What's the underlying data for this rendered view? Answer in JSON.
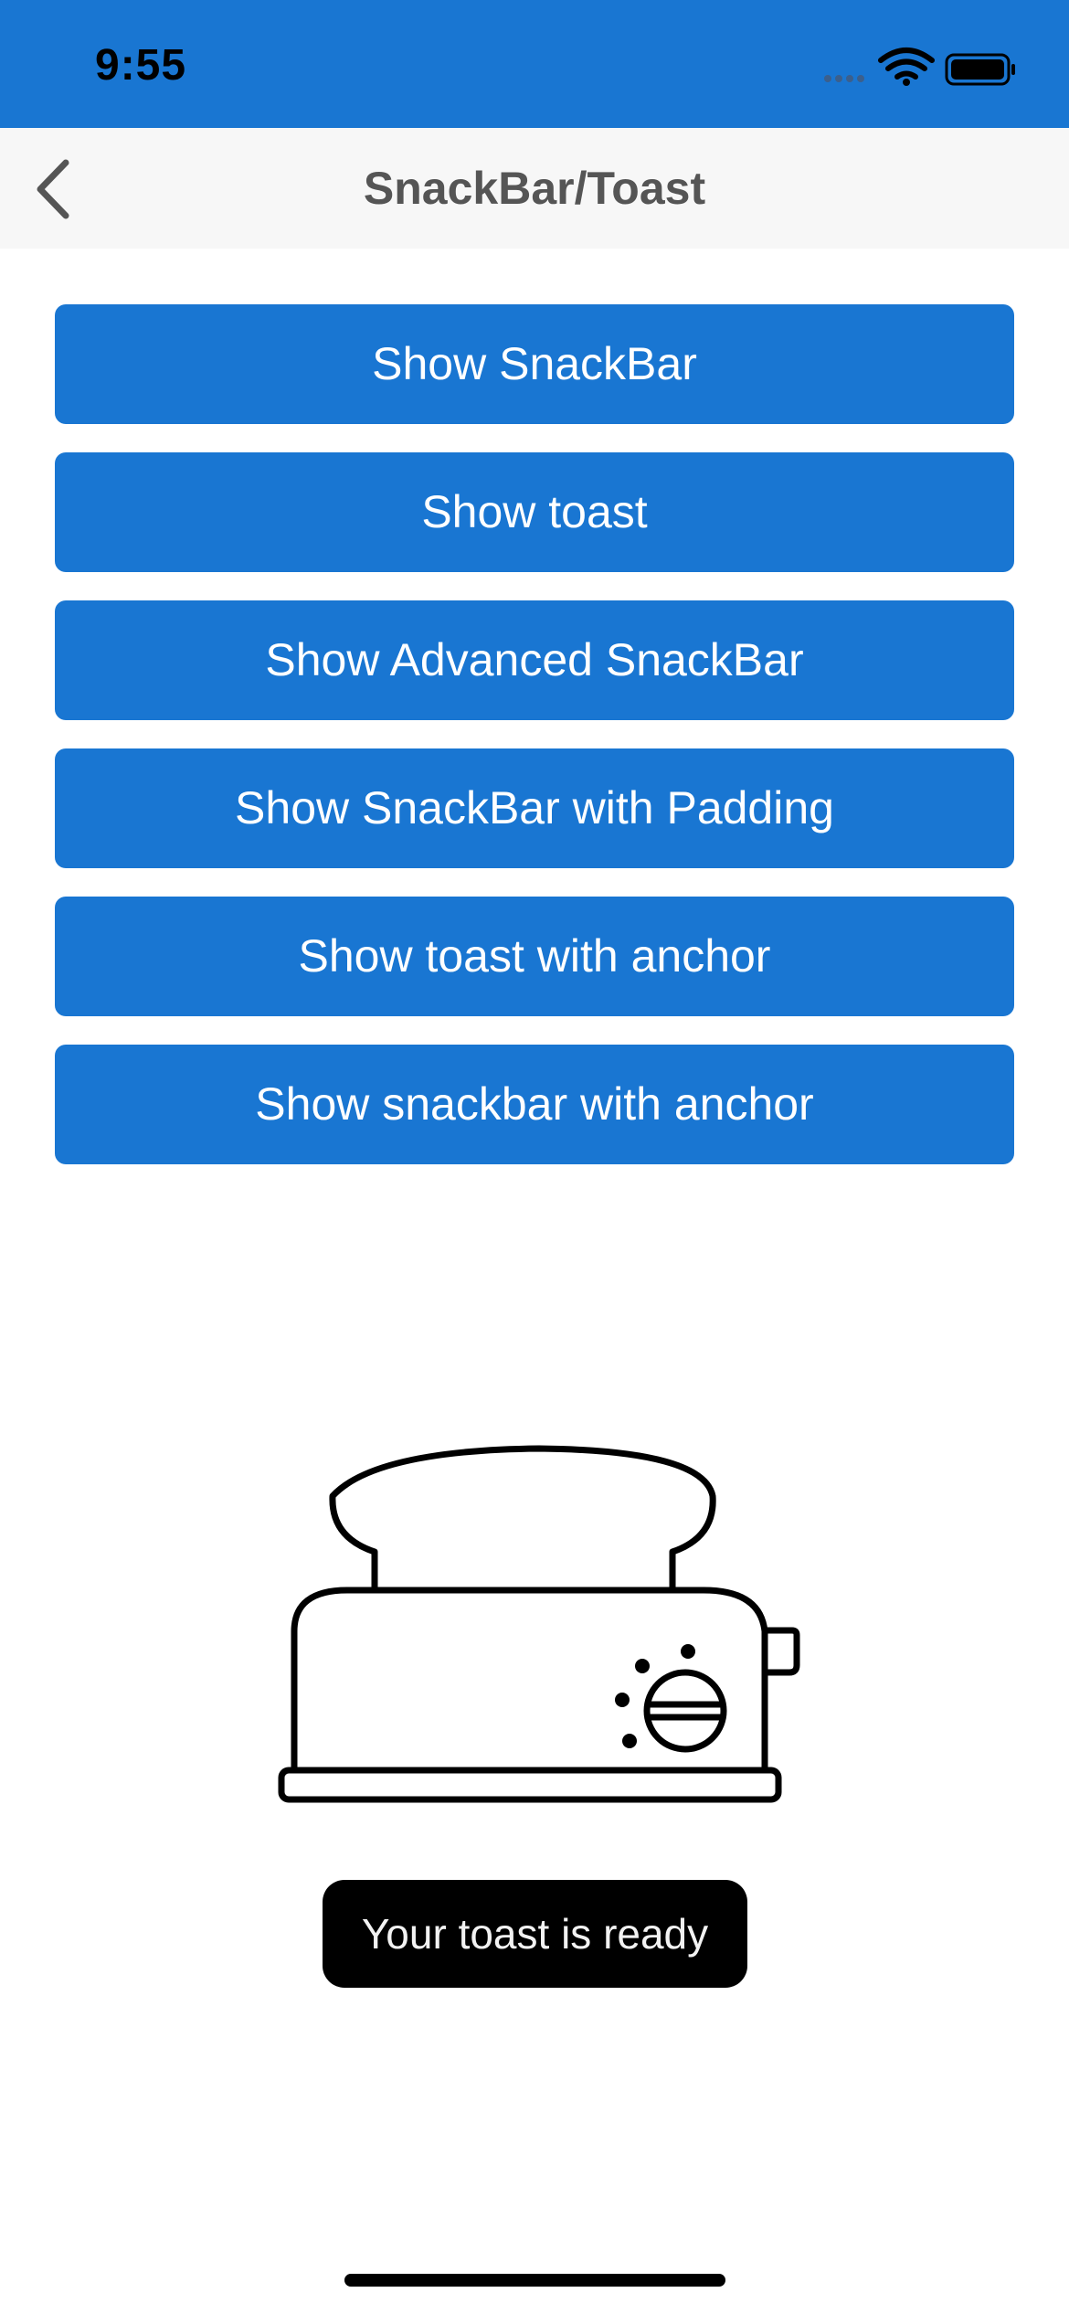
{
  "status_bar": {
    "time": "9:55",
    "icons": [
      "cellular-dots-icon",
      "wifi-icon",
      "battery-icon"
    ],
    "background": "#1976d2"
  },
  "nav": {
    "title": "SnackBar/Toast",
    "back_icon": "chevron-left-icon"
  },
  "buttons": [
    {
      "label": "Show SnackBar"
    },
    {
      "label": "Show toast"
    },
    {
      "label": "Show Advanced SnackBar"
    },
    {
      "label": "Show SnackBar with Padding"
    },
    {
      "label": "Show toast with anchor"
    },
    {
      "label": "Show snackbar with anchor"
    }
  ],
  "illustration": {
    "icon": "toaster-icon"
  },
  "toast": {
    "message": "Your toast is ready"
  },
  "colors": {
    "accent": "#1976d2",
    "toast_bg": "#000000",
    "nav_bg": "#f7f7f7"
  }
}
